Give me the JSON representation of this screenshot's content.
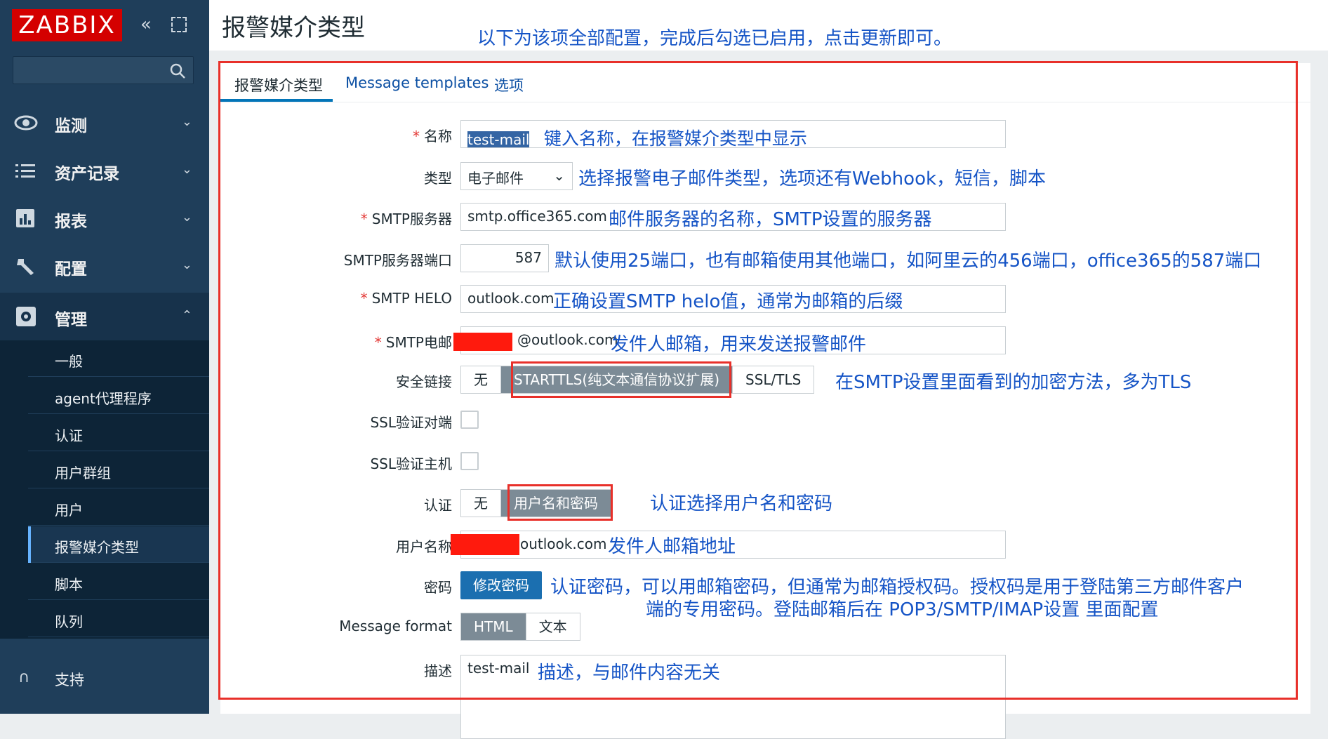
{
  "sidebar": {
    "logo": "ZABBIX",
    "collapse_glyph": "«",
    "nav": [
      {
        "label": "监测",
        "icon": "eye-icon",
        "chevron": "⌄"
      },
      {
        "label": "资产记录",
        "icon": "list-icon",
        "chevron": "⌄"
      },
      {
        "label": "报表",
        "icon": "bar-chart-icon",
        "chevron": "⌄"
      },
      {
        "label": "配置",
        "icon": "wrench-icon",
        "chevron": "⌄"
      },
      {
        "label": "管理",
        "icon": "gear-icon",
        "chevron": "⌃"
      }
    ],
    "submenu": [
      "一般",
      "agent代理程序",
      "认证",
      "用户群组",
      "用户",
      "报警媒介类型",
      "脚本",
      "队列"
    ],
    "support": "支持",
    "support_glyph": "∩"
  },
  "header": {
    "title": "报警媒介类型",
    "annotation": "以下为该项全部配置，完成后勾选已启用，点击更新即可。"
  },
  "tabs": [
    "报警媒介类型",
    "Message templates",
    "选项"
  ],
  "form": {
    "name": {
      "label": "名称",
      "value": "test-mail",
      "annotation": "键入名称，在报警媒介类型中显示"
    },
    "type": {
      "label": "类型",
      "value": "电子邮件",
      "annotation": "选择报警电子邮件类型，选项还有Webhook，短信，脚本"
    },
    "smtp_server": {
      "label": "SMTP服务器",
      "value": "smtp.office365.com",
      "annotation": "邮件服务器的名称，SMTP设置的服务器"
    },
    "smtp_port": {
      "label": "SMTP服务器端口",
      "value": "587",
      "annotation": "默认使用25端口，也有邮箱使用其他端口，如阿里云的456端口，office365的587端口"
    },
    "smtp_helo": {
      "label": "SMTP HELO",
      "value": "outlook.com",
      "annotation": "正确设置SMTP helo值，通常为邮箱的后缀"
    },
    "smtp_email": {
      "label": "SMTP电邮",
      "value": "@outlook.com",
      "annotation": "发件人邮箱，用来发送报警邮件"
    },
    "security": {
      "label": "安全链接",
      "options": [
        "无",
        "STARTTLS(纯文本通信协议扩展)",
        "SSL/TLS"
      ],
      "selected": "STARTTLS(纯文本通信协议扩展)",
      "annotation": "在SMTP设置里面看到的加密方法，多为TLS"
    },
    "ssl_verify_peer": {
      "label": "SSL验证对端",
      "checked": false
    },
    "ssl_verify_host": {
      "label": "SSL验证主机",
      "checked": false
    },
    "auth": {
      "label": "认证",
      "options": [
        "无",
        "用户名和密码"
      ],
      "selected": "用户名和密码",
      "annotation": "认证选择用户名和密码"
    },
    "username": {
      "label": "用户名称",
      "value": "outlook.com",
      "annotation": "发件人邮箱地址"
    },
    "password": {
      "label": "密码",
      "button": "修改密码",
      "annotation_line1": "认证密码，可以用邮箱密码，但通常为邮箱授权码。授权码是用于登陆第三方邮件客户",
      "annotation_line2": "端的专用密码。登陆邮箱后在 POP3/SMTP/IMAP设置 里面配置"
    },
    "message_format": {
      "label": "Message format",
      "options": [
        "HTML",
        "文本"
      ],
      "selected": "HTML"
    },
    "description": {
      "label": "描述",
      "value": "test-mail",
      "annotation": "描述，与邮件内容无关"
    }
  },
  "colors": {
    "sidebar": "#1f3e5a",
    "annotation": "#1554c6",
    "highlight_box": "#e8302a",
    "redaction": "#ff1a0d"
  }
}
